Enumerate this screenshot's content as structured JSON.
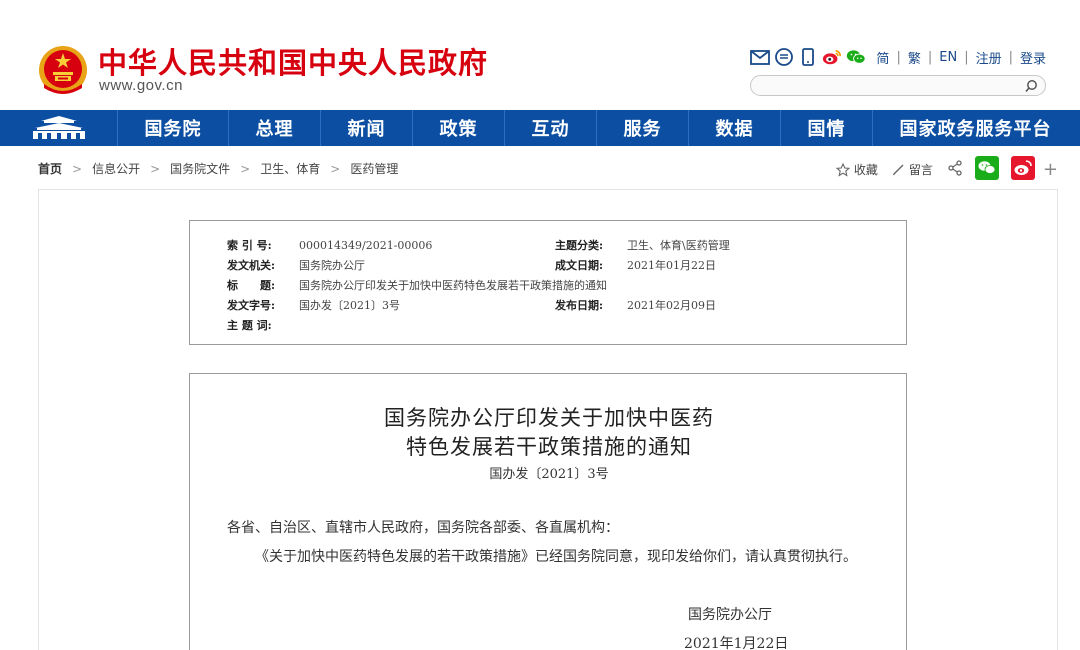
{
  "header": {
    "site_name": "中华人民共和国中央人民政府",
    "site_url": "www.gov.cn",
    "emblem_icon": "national-emblem-icon",
    "tool_icons": [
      "mail-icon",
      "message-icon",
      "mobile-icon",
      "weibo-icon",
      "wechat-icon"
    ],
    "lang_links": [
      "简",
      "繁",
      "EN",
      "注册",
      "登录"
    ],
    "search_placeholder": ""
  },
  "nav": {
    "home_icon": "tiananmen-icon",
    "items": [
      "国务院",
      "总理",
      "新闻",
      "政策",
      "互动",
      "服务",
      "数据",
      "国情",
      "国家政务服务平台"
    ]
  },
  "breadcrumb": [
    "首页",
    "信息公开",
    "国务院文件",
    "卫生、体育",
    "医药管理"
  ],
  "share": {
    "favorite": "收藏",
    "comment": "留言",
    "icons": [
      "share-icon",
      "wechat-icon",
      "weibo-icon"
    ],
    "more": "+"
  },
  "meta": {
    "index_label": "索 引 号:",
    "index_value": "000014349/2021-00006",
    "category_label": "主题分类:",
    "category_value": "卫生、体育\\医药管理",
    "issuer_label": "发文机关:",
    "issuer_value": "国务院办公厅",
    "created_label": "成文日期:",
    "created_value": "2021年01月22日",
    "title_label": "标　　题:",
    "title_value": "国务院办公厅印发关于加快中医药特色发展若干政策措施的通知",
    "docno_label": "发文字号:",
    "docno_value": "国办发〔2021〕3号",
    "published_label": "发布日期:",
    "published_value": "2021年02月09日",
    "keywords_label": "主 题 词:",
    "keywords_value": ""
  },
  "document": {
    "title_line1": "国务院办公厅印发关于加快中医药",
    "title_line2": "特色发展若干政策措施的通知",
    "number": "国办发〔2021〕3号",
    "salutation": "各省、自治区、直辖市人民政府，国务院各部委、各直属机构：",
    "body": "《关于加快中医药特色发展的若干政策措施》已经国务院同意，现印发给你们，请认真贯彻执行。",
    "signature": "国务院办公厅",
    "date": "2021年1月22日"
  },
  "colors": {
    "brand_red": "#d7000f",
    "nav_blue": "#0b4ea2",
    "link_blue": "#1a4a8a"
  }
}
